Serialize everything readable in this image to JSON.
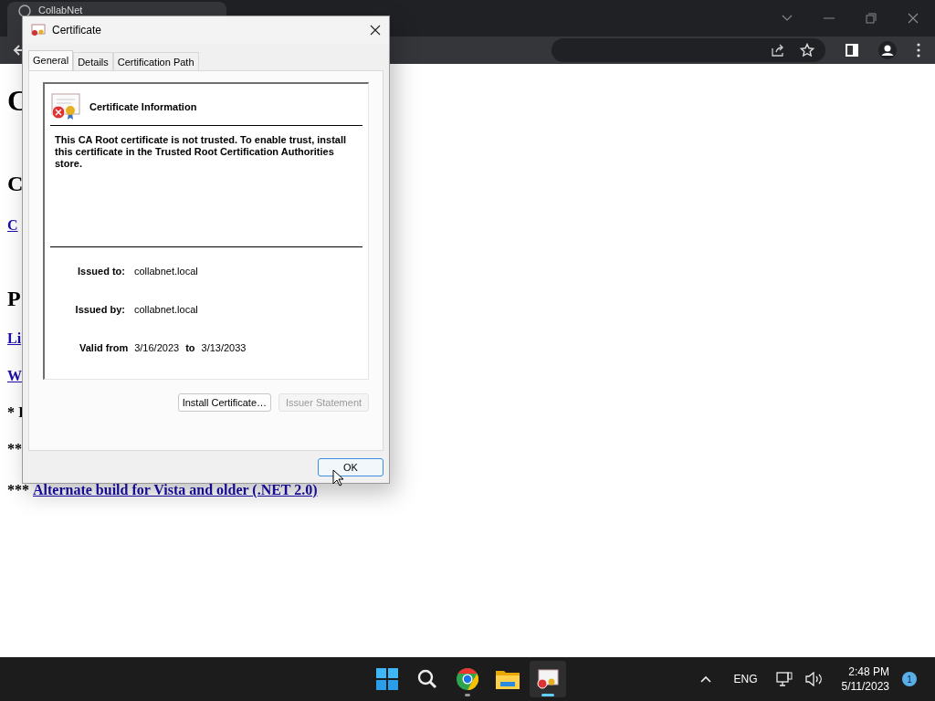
{
  "browser": {
    "tab_title": "CollabNet"
  },
  "page": {
    "lines": [
      {
        "kind": "h1",
        "text": "C"
      },
      {
        "kind": "h2",
        "text": "C"
      },
      {
        "kind": "link",
        "text": "C"
      },
      {
        "kind": "h2",
        "text": "P"
      },
      {
        "kind": "link",
        "text": "Li"
      },
      {
        "kind": "link",
        "text": "W"
      },
      {
        "kind": "text",
        "text": "* I"
      },
      {
        "kind": "text",
        "text": "**"
      },
      {
        "kind": "mixed",
        "text": "***",
        "link": "Alternate build for Vista and older (.NET 2.0)"
      }
    ]
  },
  "dialog": {
    "title": "Certificate",
    "tabs": [
      {
        "label": "General",
        "selected": true
      },
      {
        "label": "Details",
        "selected": false
      },
      {
        "label": "Certification Path",
        "selected": false
      }
    ],
    "info_title": "Certificate Information",
    "message": "This CA Root certificate is not trusted. To enable trust, install this certificate in the Trusted Root Certification Authorities store.",
    "fields": [
      {
        "label": "Issued to:",
        "value": "collabnet.local"
      },
      {
        "label": "Issued by:",
        "value": "collabnet.local"
      }
    ],
    "valid": {
      "label": "Valid from",
      "from": "3/16/2023",
      "to_label": "to",
      "to": "3/13/2033"
    },
    "buttons": [
      {
        "label": "Install Certificate…",
        "disabled": false
      },
      {
        "label": "Issuer Statement",
        "disabled": true
      }
    ],
    "ok": "OK"
  },
  "taskbar": {
    "apps": [
      {
        "kind": "start",
        "running": false,
        "active": false
      },
      {
        "kind": "search",
        "running": false,
        "active": false
      },
      {
        "kind": "chrome",
        "running": true,
        "active": false
      },
      {
        "kind": "files",
        "running": false,
        "active": false
      },
      {
        "kind": "certificate",
        "running": true,
        "active": true
      }
    ],
    "language": "ENG",
    "time": "2:48 PM",
    "date": "5/11/2023",
    "notifications": "1"
  }
}
